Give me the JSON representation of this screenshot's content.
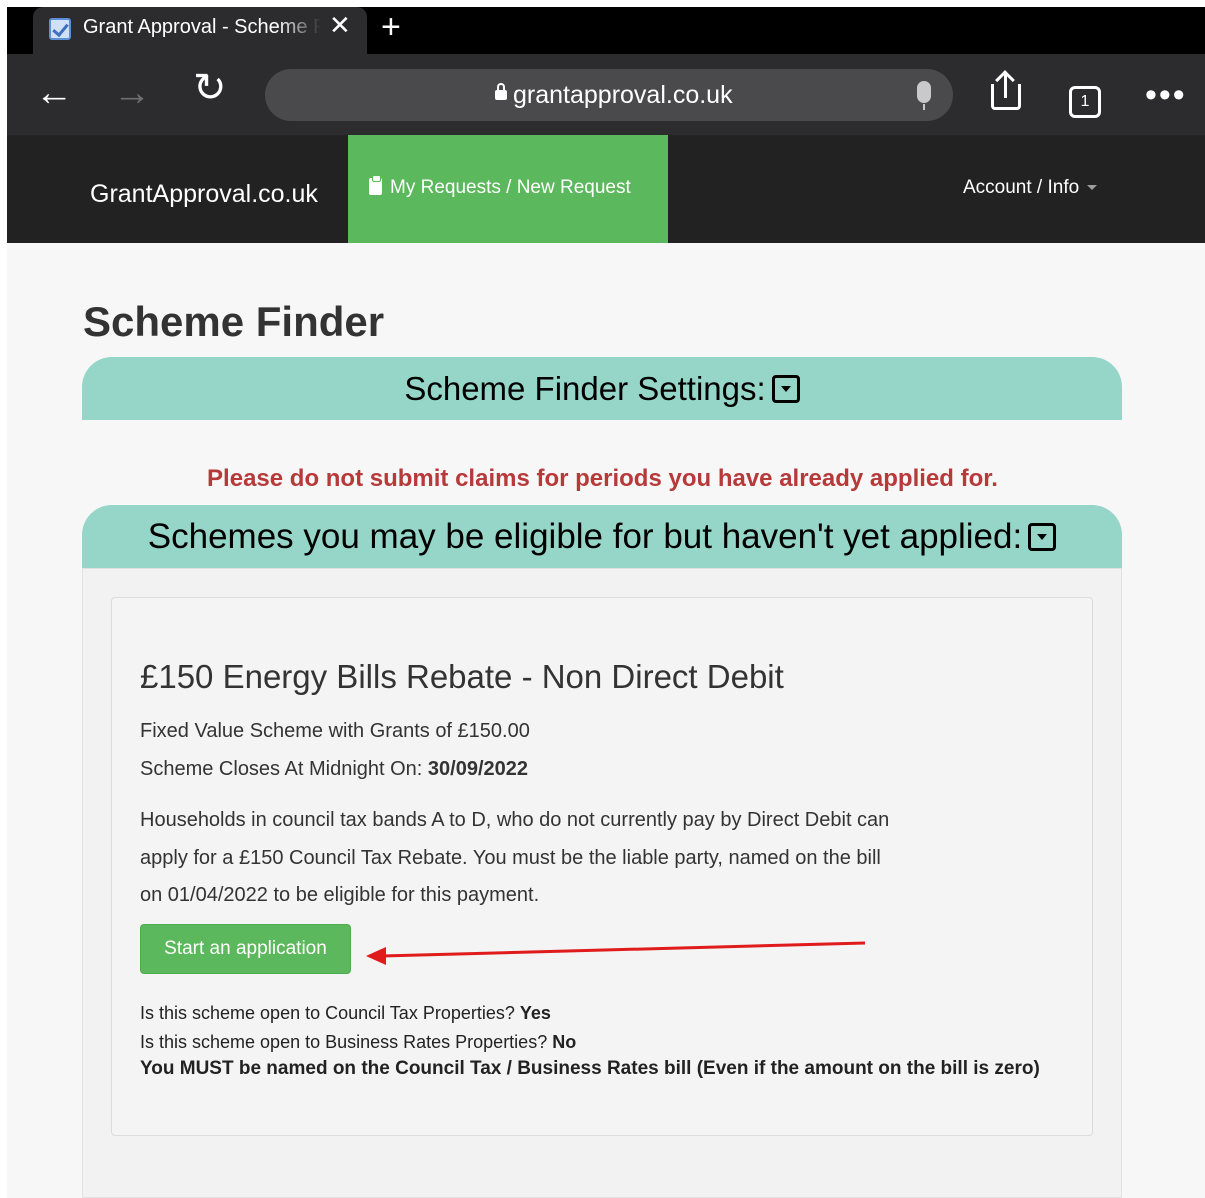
{
  "browser": {
    "tab_title": "Grant Approval - Scheme Finder",
    "tab_count": "1",
    "url": "grantapproval.co.uk",
    "icons": [
      "back-icon",
      "forward-icon",
      "reload-icon",
      "lock-icon",
      "microphone-icon",
      "share-icon",
      "tabs-icon",
      "more-icon",
      "close-icon",
      "plus-icon"
    ]
  },
  "navbar": {
    "brand": "GrantApproval.co.uk",
    "requests_link": "My Requests / New Request",
    "account_menu": "Account / Info",
    "active_color": "#5cb85c"
  },
  "page": {
    "title": "Scheme Finder",
    "settings_header": "Scheme Finder Settings:",
    "warning": "Please do not submit claims for periods you have already applied for.",
    "eligible_header": "Schemes you may be eligible for but haven't yet applied:"
  },
  "scheme": {
    "title": "£150 Energy Bills Rebate - Non Direct Debit",
    "value_text": "Fixed Value Scheme with Grants of £150.00",
    "closes_label": "Scheme Closes At Midnight On:",
    "closes_date": "30/09/2022",
    "description": "Households in council tax bands A to D, who do not currently pay by Direct Debit can apply for a £150 Council Tax Rebate. You must be the liable party, named on the bill on 01/04/2022 to be eligible for this payment.",
    "start_button": "Start an application",
    "council_tax_q": "Is this scheme open to Council Tax Properties?",
    "council_tax_a": "Yes",
    "business_rates_q": "Is this scheme open to Business Rates Properties?",
    "business_rates_a": "No",
    "must_note": "You MUST be named on the Council Tax / Business Rates bill (Even if the amount on the bill is zero)"
  }
}
